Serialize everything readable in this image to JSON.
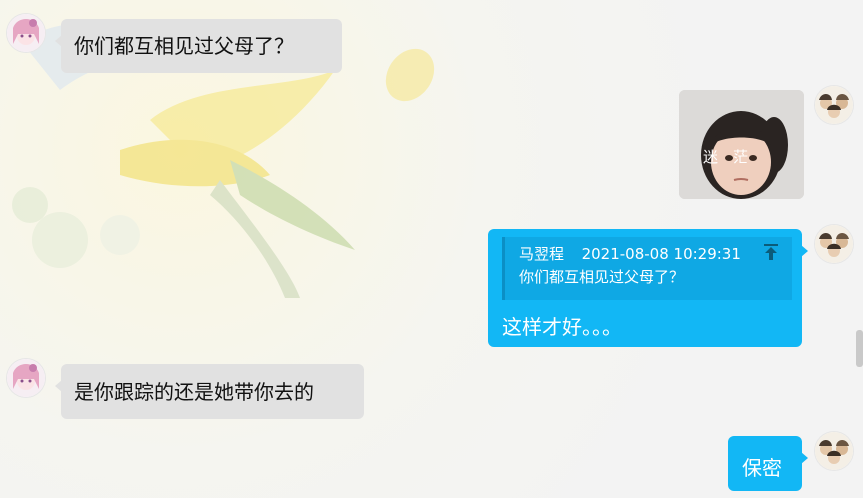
{
  "messages": [
    {
      "side": "left",
      "text": "你们都互相见过父母了？",
      "avatar": "anime-girl-avatar"
    },
    {
      "side": "right",
      "type": "image",
      "image_text": "迷　茫",
      "avatar": "group-photo-avatar"
    },
    {
      "side": "right",
      "type": "reply",
      "quote": {
        "sender": "马翌程",
        "time": "2021-08-08 10:29:31",
        "text": "你们都互相见过父母了？"
      },
      "text": "这样才好。。。",
      "avatar": "group-photo-avatar"
    },
    {
      "side": "left",
      "text": "是你跟踪的还是她带你去的",
      "avatar": "anime-girl-avatar"
    },
    {
      "side": "right",
      "text": "保密",
      "avatar": "group-photo-avatar"
    }
  ],
  "colors": {
    "right_bubble": "#12b7f5",
    "left_bubble": "#e1e1e1",
    "quote_bg": "#0fa8e4",
    "background": "#f3f3f3"
  },
  "icons": [
    "jump-to-quote-arrow-icon"
  ]
}
